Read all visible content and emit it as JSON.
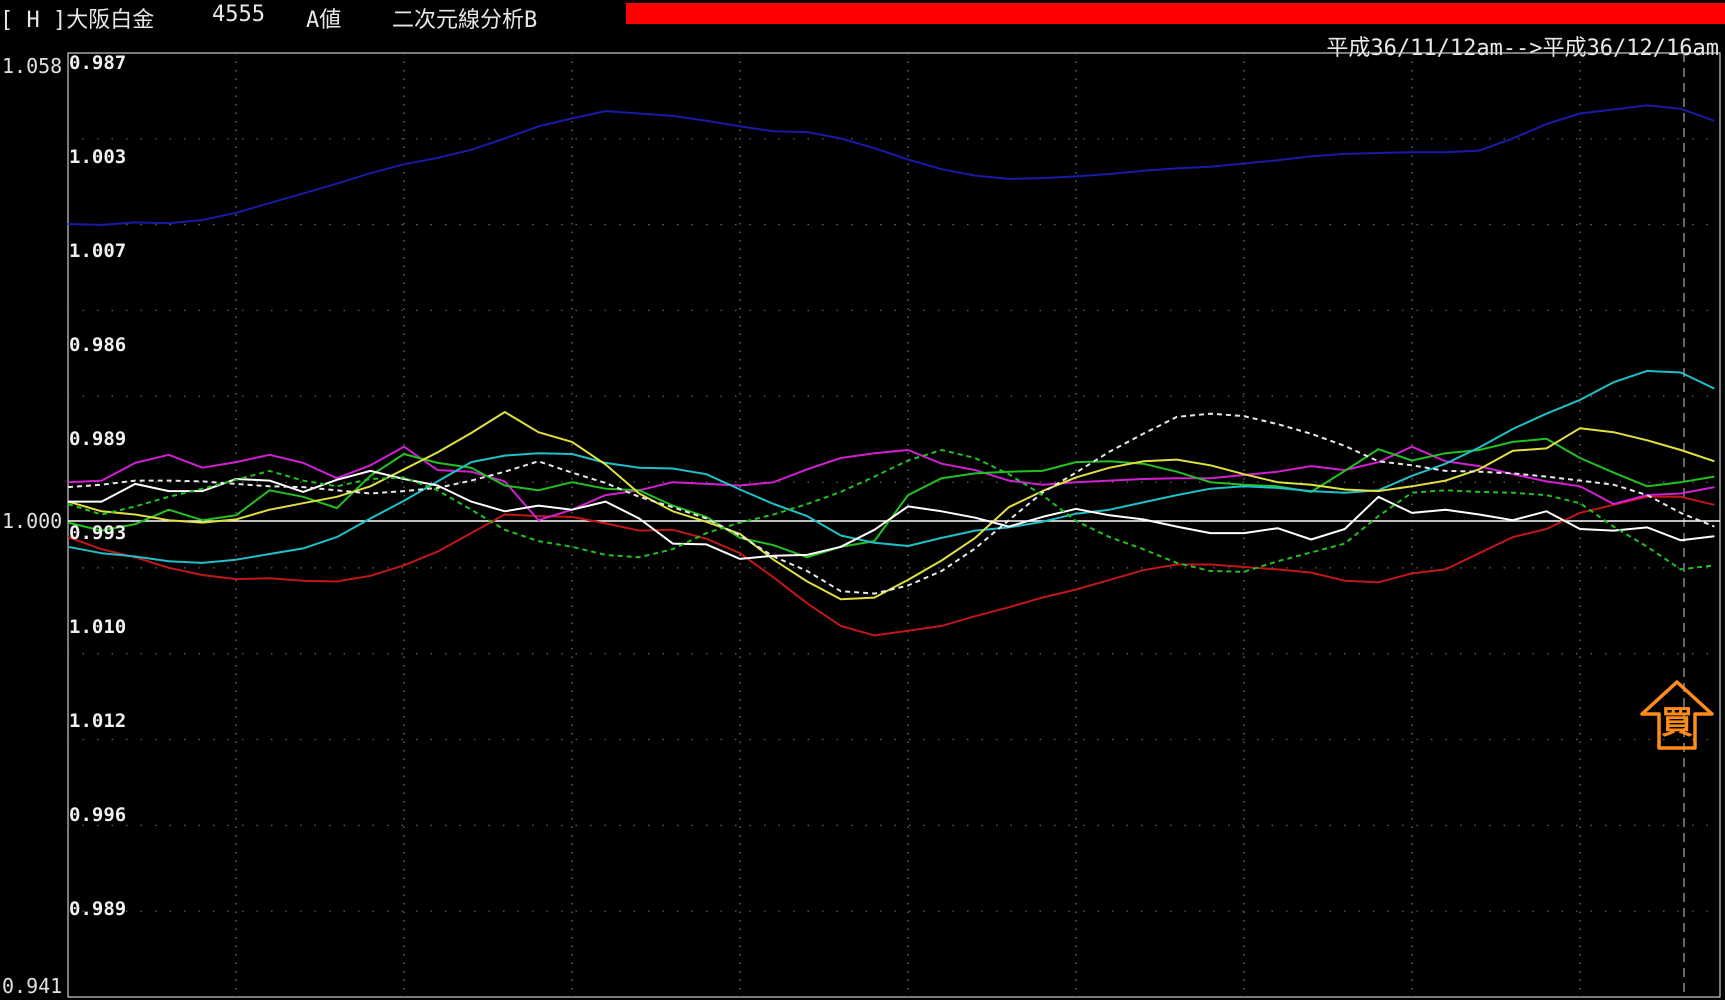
{
  "header": {
    "market": "[ H ]大阪白金",
    "code": "4555",
    "value_type": "A値",
    "analysis": "二次元線分析B",
    "date_range": "平成36/11/12am-->平成36/12/16am",
    "alert_color": "#ff0000"
  },
  "signal": {
    "label": "買",
    "color": "#ff8c1a",
    "icon": "buy-arrow-up-icon"
  },
  "chart_data": {
    "type": "line",
    "title": "",
    "xlabel": "",
    "ylabel": "",
    "ylim": [
      0.941,
      1.058
    ],
    "baseline": 1.0,
    "outer_axis_labels": [
      {
        "value": 1.058,
        "label": "1.058"
      },
      {
        "value": 1.0,
        "label": "1.000"
      },
      {
        "value": 0.941,
        "label": "0.941"
      }
    ],
    "inner_axis_labels": [
      "0.987",
      "1.003",
      "1.007",
      "0.986",
      "0.989",
      "0.993",
      "1.010",
      "1.012",
      "0.996",
      "0.989"
    ],
    "grid": true,
    "x": [
      1,
      2,
      3,
      4,
      5,
      6,
      7,
      8,
      9,
      10,
      11,
      12,
      13,
      14,
      15,
      16,
      17,
      18,
      19,
      20,
      21,
      22,
      23,
      24,
      25,
      26,
      27,
      28,
      29,
      30,
      31,
      32,
      33,
      34,
      35,
      36,
      37,
      38,
      39,
      40,
      41,
      42,
      43,
      44,
      45,
      46,
      47,
      48,
      49,
      50
    ],
    "series": [
      {
        "color": "#1a1aa8",
        "dashed": false,
        "values": [
          1.0368,
          1.0367,
          1.037,
          1.0369,
          1.0373,
          1.0382,
          1.0394,
          1.0406,
          1.0418,
          1.0431,
          1.0442,
          1.045,
          1.046,
          1.0474,
          1.0489,
          1.0499,
          1.0508,
          1.0505,
          1.0502,
          1.0496,
          1.0489,
          1.0483,
          1.0482,
          1.0474,
          1.0462,
          1.0448,
          1.0436,
          1.0428,
          1.0424,
          1.0425,
          1.0427,
          1.043,
          1.0434,
          1.0437,
          1.0439,
          1.0443,
          1.0447,
          1.0452,
          1.0455,
          1.0456,
          1.0457,
          1.0457,
          1.0459,
          1.0474,
          1.0492,
          1.0505,
          1.051,
          1.0515,
          1.0511,
          1.0496
        ]
      },
      {
        "color": "#c01818",
        "dashed": false,
        "values": [
          0.998,
          0.9965,
          0.9955,
          0.9942,
          0.9933,
          0.9928,
          0.9929,
          0.9926,
          0.9925,
          0.9932,
          0.9945,
          0.9962,
          0.9985,
          1.0008,
          1.0006,
          1.0005,
          0.9997,
          0.9988,
          0.9989,
          0.9978,
          0.996,
          0.993,
          0.9898,
          0.987,
          0.9858,
          0.9864,
          0.987,
          0.9882,
          0.9893,
          0.9905,
          0.9915,
          0.9927,
          0.9939,
          0.9946,
          0.9946,
          0.9943,
          0.994,
          0.9936,
          0.9926,
          0.9924,
          0.9935,
          0.994,
          0.996,
          0.998,
          0.999,
          1.001,
          1.002,
          1.003,
          1.003,
          1.002
        ]
      },
      {
        "color": "#d020d0",
        "dashed": false,
        "values": [
          1.0048,
          1.005,
          1.0072,
          1.0082,
          1.0066,
          1.0073,
          1.0082,
          1.0072,
          1.0053,
          1.0069,
          1.0092,
          1.0063,
          1.0061,
          1.0049,
          1.0001,
          1.0014,
          1.0032,
          1.0038,
          1.0048,
          1.0046,
          1.0044,
          1.0048,
          1.0064,
          1.0078,
          1.0084,
          1.0088,
          1.0071,
          1.0063,
          1.005,
          1.0045,
          1.0048,
          1.005,
          1.0052,
          1.0053,
          1.0053,
          1.0057,
          1.0061,
          1.0068,
          1.0063,
          1.0073,
          1.0092,
          1.0074,
          1.0068,
          1.0058,
          1.0049,
          1.0043,
          1.0021,
          1.0032,
          1.0034,
          1.0042
        ]
      },
      {
        "color": "#22c022",
        "dashed": false,
        "values": [
          0.9998,
          0.9988,
          0.9996,
          1.0014,
          1.0001,
          1.0007,
          1.0038,
          1.003,
          1.0016,
          1.0056,
          1.0083,
          1.0072,
          1.0066,
          1.0044,
          1.0038,
          1.0048,
          1.004,
          1.0038,
          1.0019,
          1.0005,
          0.9979,
          0.997,
          0.9955,
          0.9968,
          0.9975,
          1.0032,
          1.0053,
          1.0059,
          1.0061,
          1.0062,
          1.0073,
          1.0074,
          1.0071,
          1.0061,
          1.0048,
          1.0045,
          1.0043,
          1.0036,
          1.0062,
          1.0089,
          1.0075,
          1.0084,
          1.0088,
          1.0098,
          1.0102,
          1.0078,
          1.006,
          1.0043,
          1.0048,
          1.0055
        ]
      },
      {
        "color": "#20c0c8",
        "dashed": false,
        "values": [
          0.9968,
          0.996,
          0.9956,
          0.995,
          0.9948,
          0.9952,
          0.9959,
          0.9966,
          0.998,
          1.0003,
          1.0025,
          1.0049,
          1.0073,
          1.0081,
          1.0084,
          1.0083,
          1.0072,
          1.0066,
          1.0065,
          1.0058,
          1.0039,
          1.0021,
          1.0006,
          0.9982,
          0.9973,
          0.9969,
          0.9979,
          0.9988,
          0.9992,
          0.9999,
          1.0009,
          1.0014,
          1.0023,
          1.0032,
          1.004,
          1.0043,
          1.0041,
          1.0037,
          1.0035,
          1.0038,
          1.0056,
          1.0071,
          1.0091,
          1.0114,
          1.0133,
          1.015,
          1.0172,
          1.0186,
          1.0184,
          1.0164
        ]
      },
      {
        "color": "#e0e040",
        "dashed": false,
        "values": [
          1.0024,
          1.0012,
          1.0008,
          1.0001,
          0.9998,
          1.0002,
          1.0014,
          1.0022,
          1.003,
          1.0043,
          1.0064,
          1.0085,
          1.0109,
          1.0135,
          1.011,
          1.0098,
          1.007,
          1.0034,
          1.0012,
          0.9999,
          0.9984,
          0.9952,
          0.9925,
          0.9903,
          0.9905,
          0.9927,
          0.9951,
          0.9979,
          1.0017,
          1.0037,
          1.0054,
          1.0066,
          1.0074,
          1.0076,
          1.0069,
          1.0058,
          1.0048,
          1.0045,
          1.0039,
          1.0037,
          1.0043,
          1.005,
          1.0064,
          1.0087,
          1.009,
          1.0115,
          1.011,
          1.01,
          1.0088,
          1.0074
        ]
      },
      {
        "color": "#ffffff",
        "dashed": false,
        "values": [
          1.0024,
          1.0024,
          1.0046,
          1.0037,
          1.0037,
          1.0052,
          1.005,
          1.0036,
          1.0051,
          1.0062,
          1.0052,
          1.0044,
          1.0024,
          1.0012,
          1.0019,
          1.0014,
          1.0024,
          1.0003,
          0.9972,
          0.9971,
          0.9953,
          0.9957,
          0.9958,
          0.9968,
          0.9989,
          1.0018,
          1.0012,
          1.0004,
          0.9993,
          1.0005,
          1.0015,
          1.0007,
          1.0002,
          0.9993,
          0.9985,
          0.9985,
          0.9991,
          0.9977,
          0.999,
          1.003,
          1.001,
          1.0014,
          1.0008,
          1.0001,
          1.0012,
          0.999,
          0.9988,
          0.9992,
          0.9976,
          0.9981
        ]
      },
      {
        "color": "#e8e8e8",
        "dashed": true,
        "values": [
          1.0042,
          1.0045,
          1.005,
          1.005,
          1.0049,
          1.0046,
          1.0043,
          1.0042,
          1.0038,
          1.0034,
          1.0037,
          1.0041,
          1.005,
          1.0061,
          1.0074,
          1.006,
          1.0047,
          1.003,
          1.0017,
          1.0003,
          0.9982,
          0.9956,
          0.9938,
          0.9913,
          0.991,
          0.992,
          0.9938,
          0.9966,
          1.0001,
          1.0035,
          1.006,
          1.0086,
          1.0108,
          1.0129,
          1.0133,
          1.013,
          1.012,
          1.0108,
          1.0093,
          1.0074,
          1.0069,
          1.0062,
          1.0061,
          1.0059,
          1.0055,
          1.005,
          1.0045,
          1.0032,
          1.001,
          0.9993
        ]
      },
      {
        "color": "#22c022",
        "dashed": true,
        "values": [
          1.0021,
          1.0008,
          1.0018,
          1.003,
          1.004,
          1.0051,
          1.0062,
          1.005,
          1.0043,
          1.0052,
          1.0054,
          1.0038,
          1.0014,
          0.9989,
          0.9975,
          0.9968,
          0.9958,
          0.9955,
          0.9965,
          0.9985,
          0.9998,
          1.0008,
          1.0021,
          1.0036,
          1.0055,
          1.0075,
          1.0088,
          1.0078,
          1.0058,
          1.0032,
          1.0,
          0.998,
          0.9965,
          0.9948,
          0.9938,
          0.9937,
          0.995,
          0.9961,
          0.9972,
          1.0006,
          1.0035,
          1.0038,
          1.0036,
          1.0035,
          1.0032,
          1.0022,
          0.9993,
          0.9968,
          0.994,
          0.9945
        ]
      }
    ]
  }
}
